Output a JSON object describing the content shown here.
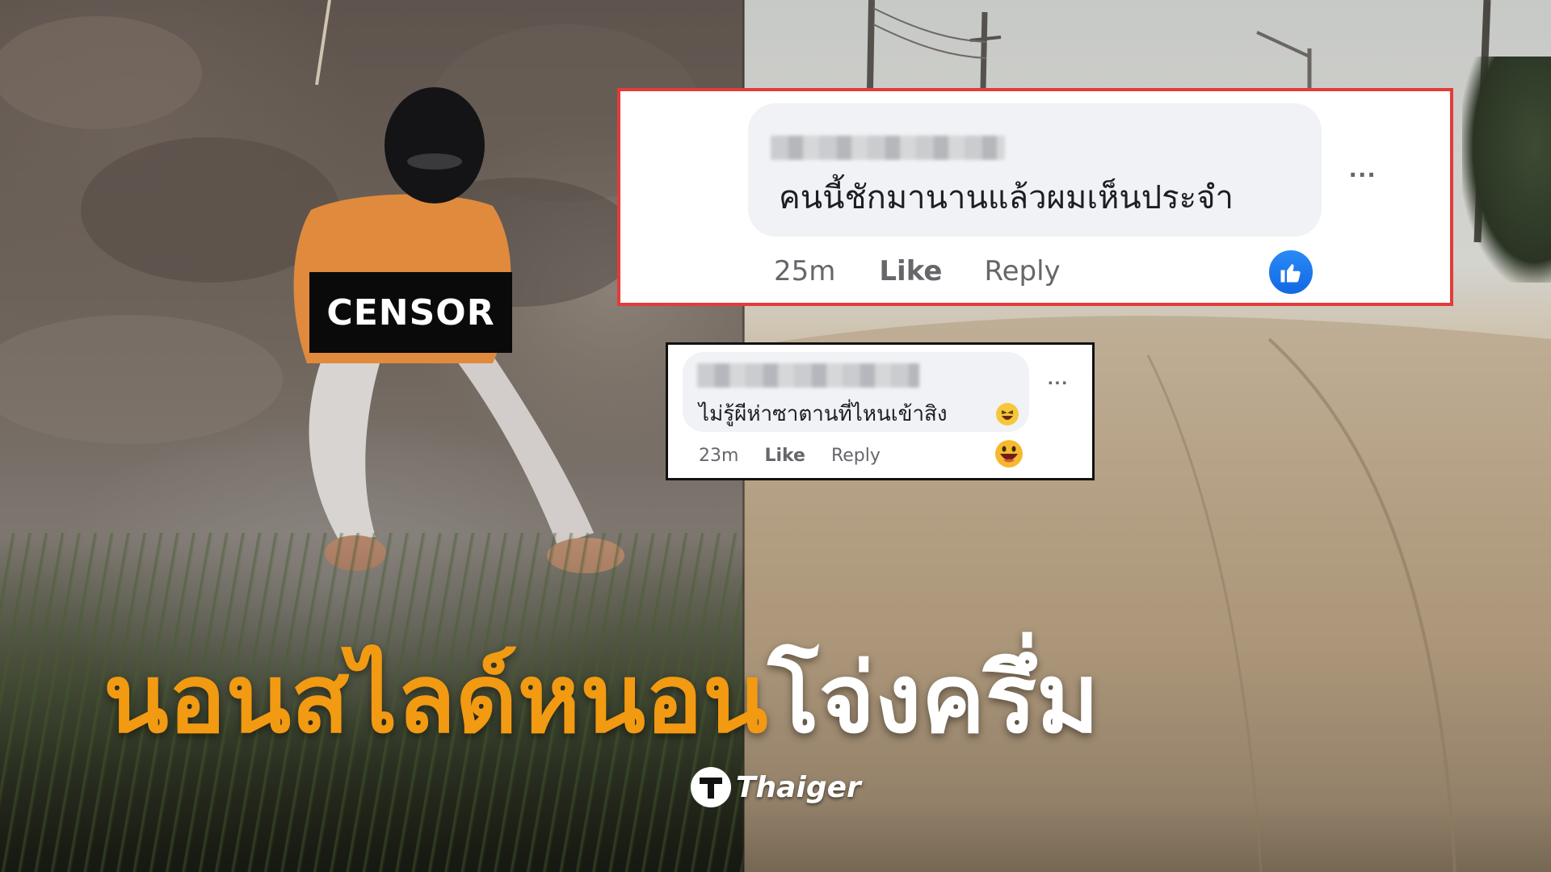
{
  "censor": {
    "label": "CENSOR"
  },
  "comment_1": {
    "text": "คนนี้ชักมานานแล้วผมเห็นประจำ",
    "time": "25m",
    "like": "Like",
    "reply": "Reply",
    "more": "...",
    "reaction": "thumbs-up-icon"
  },
  "comment_2": {
    "text": "ไม่รู้ผีห่าซาตานที่ไหนเข้าสิง",
    "time": "23m",
    "like": "Like",
    "reply": "Reply",
    "more": "...",
    "reaction": "laughing-face-icon"
  },
  "headline": {
    "orange_part": "นอนสไลด์หนอน",
    "white_part": "โจ่งครึ่ม"
  },
  "brand": {
    "name": "Thaiger"
  },
  "colors": {
    "headline_accent": "#f29a12",
    "highlight_border": "#e33b3b",
    "facebook_blue": "#1877f2"
  }
}
